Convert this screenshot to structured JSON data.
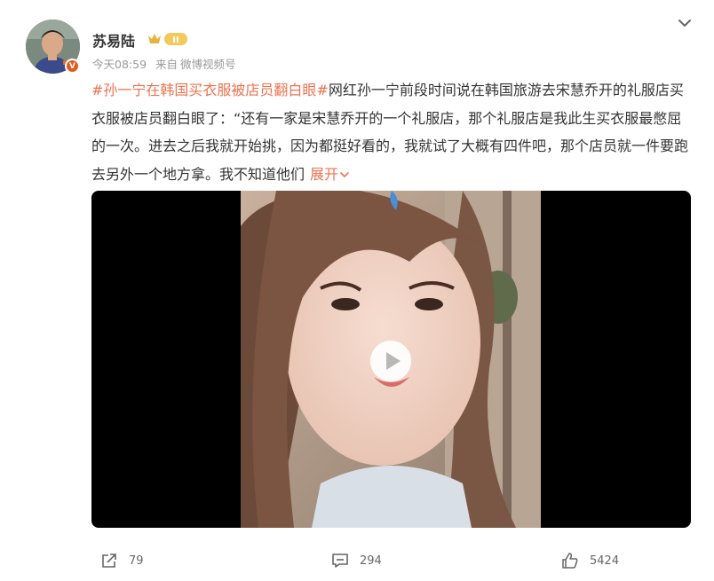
{
  "author": {
    "name": "苏易陆",
    "level_badge": "II",
    "verified_badge": "V"
  },
  "meta": {
    "time": "今天08:59",
    "source_prefix": "来自",
    "source": "微博视频号"
  },
  "post": {
    "hashtag": "#孙一宁在韩国买衣服被店员翻白眼#",
    "body": "网红孙一宁前段时间说在韩国旅游去宋慧乔开的礼服店买衣服被店员翻白眼了：“还有一家是宋慧乔开的一个礼服店，那个礼服店是我此生买衣服最憋屈的一次。进去之后我就开始挑，因为都挺好看的，我就试了大概有四件吧，那个店员就一件要跑去另外一个地方拿。我不知道他们",
    "expand_label": "展开"
  },
  "actions": {
    "share_count": "79",
    "comment_count": "294",
    "like_count": "5424"
  },
  "icons": {
    "menu": "chevron-down-icon",
    "share": "share-icon",
    "comment": "comment-icon",
    "like": "thumbs-up-icon",
    "play": "play-icon"
  },
  "colors": {
    "hashtag": "#eb7350",
    "meta_text": "#999999",
    "badge_gold": "#e8b33c"
  }
}
